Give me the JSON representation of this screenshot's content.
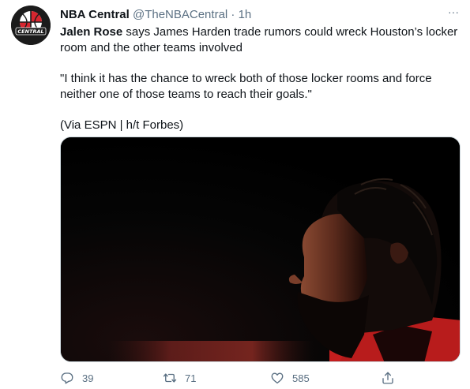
{
  "tweet": {
    "author": {
      "name": "NBA Central",
      "handle": "@TheNBACentral",
      "separator": "·",
      "time": "1h",
      "avatar_text": "CENTRAL"
    },
    "text": {
      "mention": "Jalen Rose",
      "line1_rest": " says James Harden trade rumors could wreck Houston’s locker room and the other teams involved",
      "quote": "\"I think it has the chance to wreck both of those locker rooms and force neither one of those teams to reach their goals.\"",
      "source": "(Via ESPN | h/t Forbes)"
    },
    "more_label": "···",
    "actions": {
      "reply_count": "39",
      "retweet_count": "71",
      "like_count": "585"
    }
  },
  "icons": {
    "reply": "reply-icon",
    "retweet": "retweet-icon",
    "like": "heart-icon",
    "share": "share-icon",
    "more": "more-icon"
  },
  "colors": {
    "text": "#0f1419",
    "muted": "#5b7083",
    "brand_red": "#d8262f"
  }
}
